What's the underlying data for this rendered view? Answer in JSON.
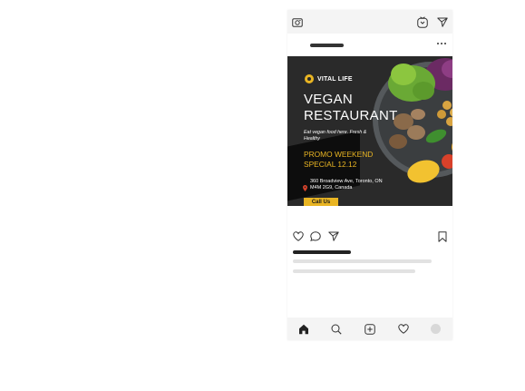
{
  "ad": {
    "brand": "VITAL LIFE",
    "title": "VEGAN RESTAURANT",
    "subtitle": "Eat vegan food here. Fresh & Healthy",
    "promo": "PROMO WEEKEND SPECIAL 12.12",
    "address": "360 Broadview Ave, Toronto, ON M4M 2G9, Canada",
    "cta": "Call Us"
  },
  "colors": {
    "accent": "#e9b523",
    "ad_background": "#2a2a2a",
    "bar_background": "#f4f4f4"
  },
  "icons": {
    "top": [
      "camera-icon",
      "igtv-icon",
      "direct-message-icon"
    ],
    "post": [
      "more-options-icon"
    ],
    "actions": [
      "like-icon",
      "comment-icon",
      "share-icon",
      "bookmark-icon"
    ],
    "nav": [
      "home-icon",
      "search-icon",
      "new-post-icon",
      "activity-icon",
      "profile-avatar"
    ]
  }
}
